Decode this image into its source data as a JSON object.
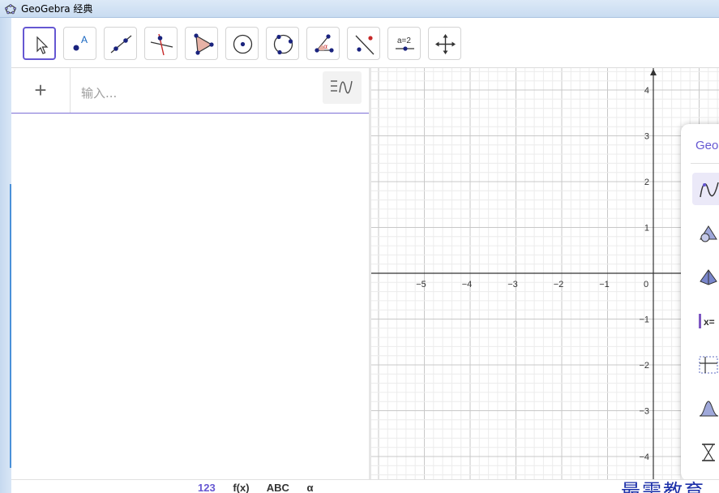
{
  "window": {
    "title": "GeoGebra 经典"
  },
  "toolbar": {
    "tools": [
      {
        "name": "move-tool",
        "icon": "arrow-cursor-icon",
        "selected": true
      },
      {
        "name": "point-tool",
        "icon": "point-icon",
        "label": "A"
      },
      {
        "name": "line-tool",
        "icon": "line-through-points-icon"
      },
      {
        "name": "perpendicular-line-tool",
        "icon": "perpendicular-line-icon"
      },
      {
        "name": "polygon-tool",
        "icon": "polygon-icon"
      },
      {
        "name": "circle-center-point-tool",
        "icon": "circle-center-icon"
      },
      {
        "name": "circle-three-points-tool",
        "icon": "circle-three-points-icon"
      },
      {
        "name": "angle-tool",
        "icon": "angle-icon",
        "label": "α"
      },
      {
        "name": "reflect-line-tool",
        "icon": "reflect-about-line-icon"
      },
      {
        "name": "slider-tool",
        "icon": "slider-icon",
        "label": "a=2"
      },
      {
        "name": "move-graphics-tool",
        "icon": "move-view-icon"
      }
    ]
  },
  "algebra": {
    "add_symbol": "+",
    "input_placeholder": "输入..."
  },
  "graphics": {
    "x_ticks": [
      "−5",
      "−4",
      "−3",
      "−2",
      "−1",
      "0"
    ],
    "y_ticks": [
      "4",
      "3",
      "2",
      "1",
      "−1",
      "−2",
      "−3",
      "−4"
    ],
    "grid": true
  },
  "perspectives_panel": {
    "title": "Geo",
    "items": [
      {
        "name": "graphing",
        "icon": "graph-curve-icon",
        "active": true
      },
      {
        "name": "geometry",
        "icon": "geometry-shapes-icon"
      },
      {
        "name": "3d-graphics",
        "icon": "pyramid-icon"
      },
      {
        "name": "cas",
        "icon": "cas-icon",
        "label": "x="
      },
      {
        "name": "spreadsheet",
        "icon": "table-icon"
      },
      {
        "name": "probability",
        "icon": "bell-curve-icon"
      },
      {
        "name": "exam",
        "icon": "hourglass-icon"
      }
    ]
  },
  "bottombar": {
    "items": [
      "123",
      "f(x)",
      "ABC",
      "α"
    ]
  },
  "watermark": "最需教育",
  "colors": {
    "accent": "#6557d2",
    "point": "#1565c0",
    "title_bar": "#d4e4f5"
  }
}
